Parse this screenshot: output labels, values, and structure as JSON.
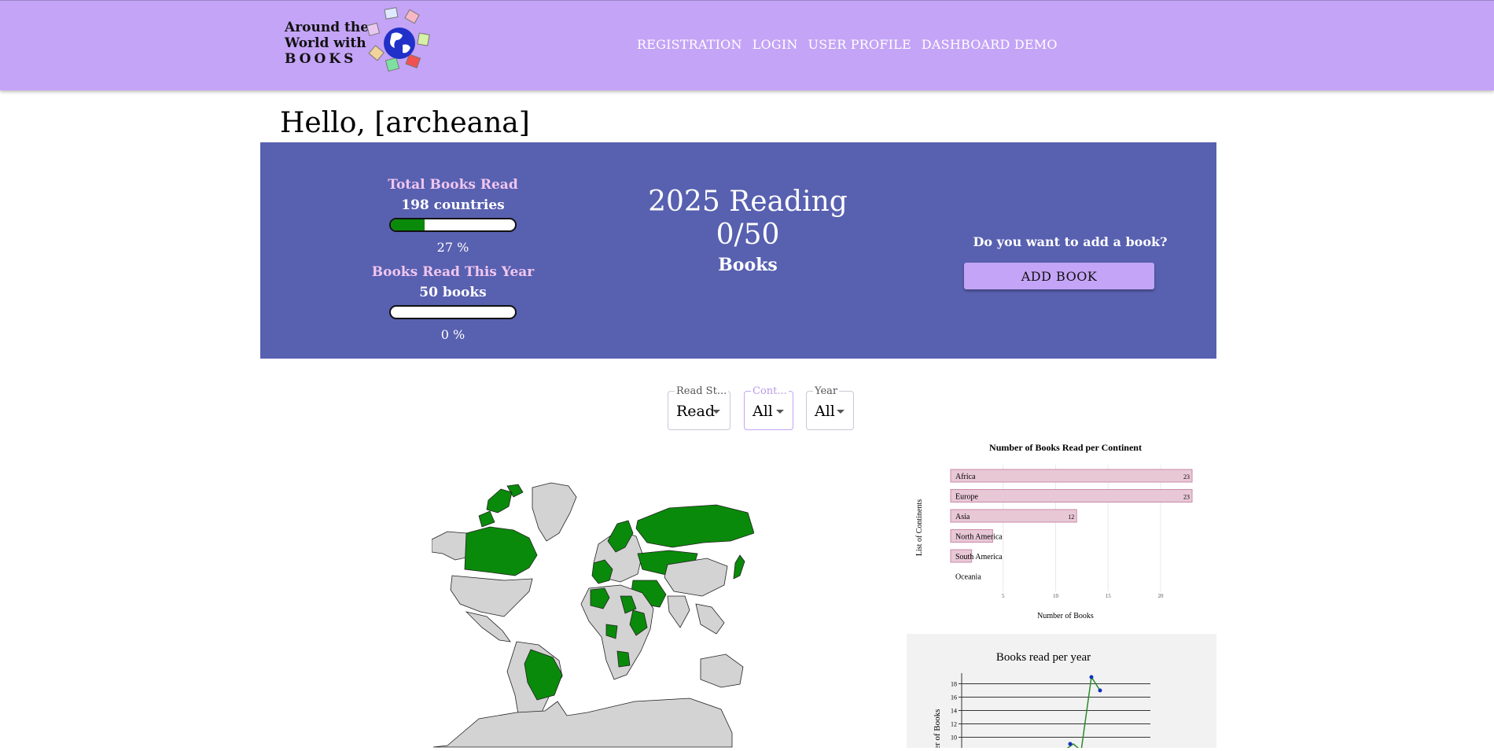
{
  "header": {
    "logo": {
      "line1": "Around the",
      "line2": "World with",
      "line3": "BOOKS"
    },
    "nav": [
      "REGISTRATION",
      "LOGIN",
      "USER PROFILE",
      "DASHBOARD DEMO"
    ]
  },
  "greeting": "Hello, [archeana]",
  "stats": {
    "total": {
      "title": "Total Books Read",
      "value": "198 countries",
      "percent_label": "27 %",
      "progress": 0.27
    },
    "year": {
      "title": "Books Read This Year",
      "value": "50 books",
      "percent_label": "0 %",
      "progress": 0
    },
    "center": {
      "line1": "2025 Reading",
      "line2": "0/50",
      "line3": "Books"
    },
    "add": {
      "question": "Do you want to add a book?",
      "button": "ADD BOOK"
    }
  },
  "filters": [
    {
      "label": "Read St...",
      "value": "Read"
    },
    {
      "label": "Cont...",
      "value": "All"
    },
    {
      "label": "Year",
      "value": "All"
    }
  ],
  "colors": {
    "header": "#c4a4f6",
    "panel": "#5860b0",
    "visited": "#0a8a0a",
    "unvisited": "#d3d3d3",
    "bar_fill": "#e9c8d6",
    "bar_stroke": "#c98aa8"
  },
  "chart_data": [
    {
      "type": "bar",
      "orientation": "horizontal",
      "title": "Number of Books Read per Continent",
      "xlabel": "Number of Books",
      "ylabel": "List of Continents",
      "categories": [
        "Africa",
        "Europe",
        "Asia",
        "North America",
        "South America",
        "Oceania"
      ],
      "values": [
        23,
        23,
        12,
        4,
        2,
        0
      ],
      "xticks": [
        "5",
        "10",
        "15",
        "20"
      ],
      "xlim": [
        0,
        23
      ]
    },
    {
      "type": "line",
      "title": "Books read per year",
      "ylabel": "Number of Books",
      "yticks": [
        "10",
        "12",
        "14",
        "16",
        "18"
      ],
      "ylim": [
        8,
        19
      ],
      "x": [
        1,
        2,
        3,
        4,
        5
      ],
      "y": [
        8,
        9,
        8,
        19,
        17
      ]
    }
  ]
}
